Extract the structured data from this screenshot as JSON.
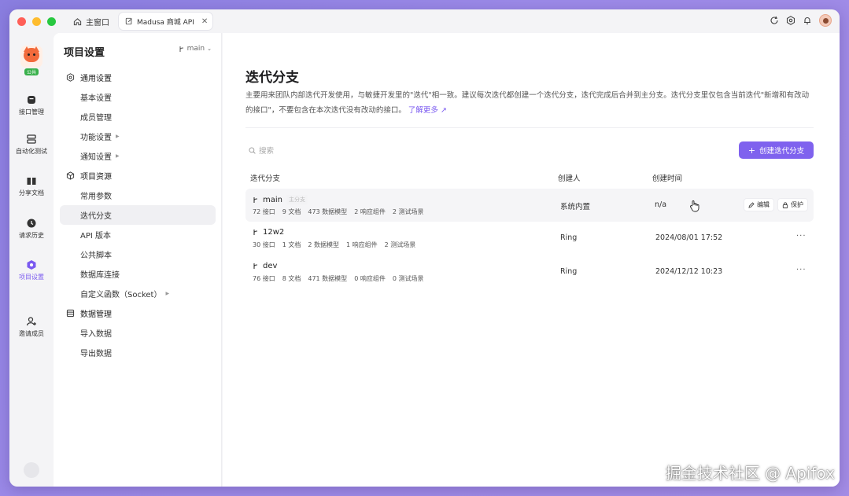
{
  "titlebar": {
    "home_tab": "主窗口",
    "api_tab": "Madusa 商城 API"
  },
  "rail": {
    "badge": "公共",
    "items": [
      {
        "label": "接口管理"
      },
      {
        "label": "自动化测试"
      },
      {
        "label": "分享文档"
      },
      {
        "label": "请求历史"
      },
      {
        "label": "项目设置"
      },
      {
        "label": "邀请成员"
      }
    ]
  },
  "settings": {
    "title": "项目设置",
    "branch": "main",
    "groups": [
      {
        "label": "通用设置",
        "items": [
          "基本设置",
          "成员管理",
          "功能设置",
          "通知设置"
        ]
      },
      {
        "label": "项目资源",
        "items": [
          "常用参数",
          "迭代分支",
          "API 版本",
          "公共脚本",
          "数据库连接",
          "自定义函数（Socket）"
        ]
      },
      {
        "label": "数据管理",
        "items": [
          "导入数据",
          "导出数据"
        ]
      }
    ]
  },
  "main": {
    "title": "迭代分支",
    "desc": "主要用来团队内部迭代开发使用，与敏捷开发里的\"迭代\"相一致。建议每次迭代都创建一个迭代分支，迭代完成后合并到主分支。迭代分支里仅包含当前迭代\"新增和有改动的接口\"，不要包含在本次迭代没有改动的接口。",
    "learn_more": "了解更多 ↗",
    "search_placeholder": "搜索",
    "create_button": "创建迭代分支",
    "columns": {
      "branch": "迭代分支",
      "creator": "创建人",
      "created_at": "创建时间"
    },
    "rows": [
      {
        "name": "main",
        "tag": "主分支",
        "stats": [
          "72 接口",
          "9 文档",
          "473 数据模型",
          "2 响应组件",
          "2 测试场景"
        ],
        "creator": "系统内置",
        "time": "n/a",
        "edit": "编辑",
        "protect": "保护"
      },
      {
        "name": "12w2",
        "stats": [
          "30 接口",
          "1 文档",
          "2 数据模型",
          "1 响应组件",
          "2 测试场景"
        ],
        "creator": "Ring",
        "time": "2024/08/01 17:52",
        "more": "···"
      },
      {
        "name": "dev",
        "stats": [
          "76 接口",
          "8 文档",
          "471 数据模型",
          "0 响应组件",
          "0 测试场景"
        ],
        "creator": "Ring",
        "time": "2024/12/12 10:23",
        "more": "···"
      }
    ]
  },
  "watermark": "掘金技术社区 @ Apifox",
  "colors": {
    "accent": "#7f62ee",
    "background": "#9c8ae8"
  }
}
